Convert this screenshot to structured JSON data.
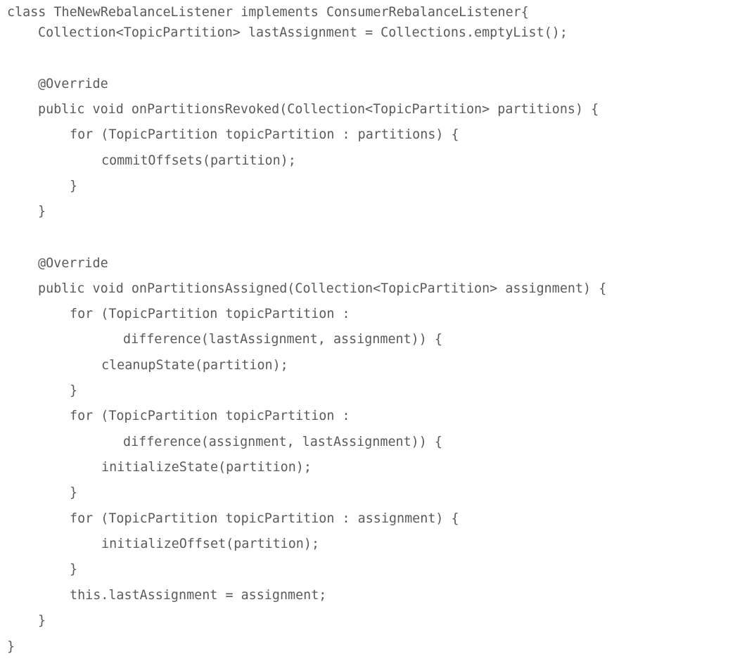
{
  "code": {
    "lines": [
      "class TheNewRebalanceListener implements ConsumerRebalanceListener{",
      "Collection<TopicPartition> lastAssignment = Collections.emptyList();",
      "@Override",
      "public void onPartitionsRevoked(Collection<TopicPartition> partitions) {",
      "for (TopicPartition topicPartition : partitions) {",
      "commitOffsets(partition);",
      "}",
      "}",
      "@Override",
      "public void onPartitionsAssigned(Collection<TopicPartition> assignment) {",
      "for (TopicPartition topicPartition :",
      "difference(lastAssignment, assignment)) {",
      "cleanupState(partition);",
      "}",
      "for (TopicPartition topicPartition :",
      "difference(assignment, lastAssignment)) {",
      "initializeState(partition);",
      "}",
      "for (TopicPartition topicPartition : assignment) {",
      "initializeOffset(partition);",
      "}",
      "this.lastAssignment = assignment;",
      "}",
      "}"
    ]
  }
}
